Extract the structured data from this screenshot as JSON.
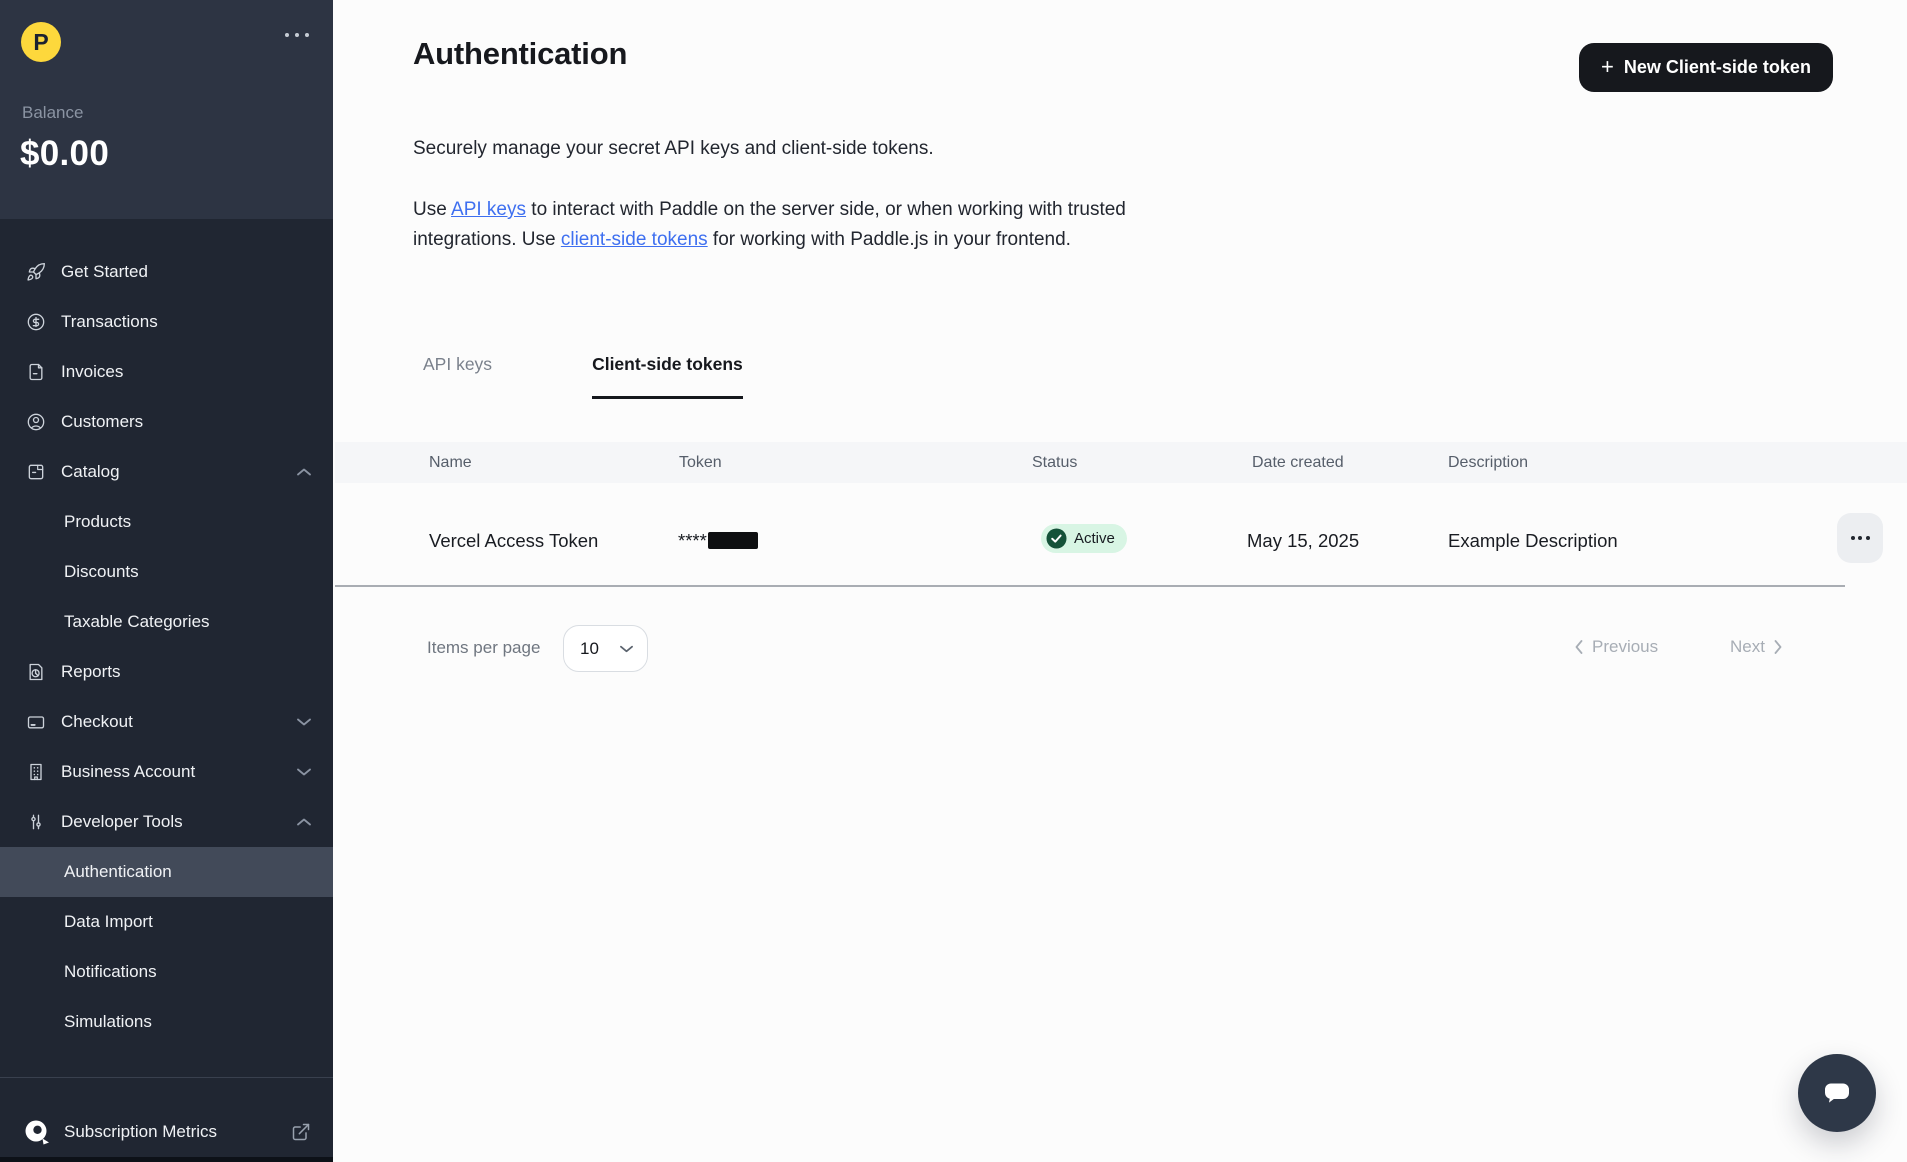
{
  "sidebar": {
    "logo_letter": "P",
    "balance_label": "Balance",
    "balance_value": "$0.00",
    "items": [
      {
        "label": "Get Started",
        "icon": "rocket-icon"
      },
      {
        "label": "Transactions",
        "icon": "dollar-circle-icon"
      },
      {
        "label": "Invoices",
        "icon": "invoice-icon"
      },
      {
        "label": "Customers",
        "icon": "user-circle-icon"
      },
      {
        "label": "Catalog",
        "icon": "box-icon",
        "chevron": "up"
      },
      {
        "label": "Products",
        "sub": true
      },
      {
        "label": "Discounts",
        "sub": true
      },
      {
        "label": "Taxable Categories",
        "sub": true
      },
      {
        "label": "Reports",
        "icon": "report-icon"
      },
      {
        "label": "Checkout",
        "icon": "credit-card-icon",
        "chevron": "down"
      },
      {
        "label": "Business Account",
        "icon": "building-icon",
        "chevron": "down"
      },
      {
        "label": "Developer Tools",
        "icon": "sliders-icon",
        "chevron": "up"
      },
      {
        "label": "Authentication",
        "sub": true,
        "selected": true
      },
      {
        "label": "Data Import",
        "sub": true
      },
      {
        "label": "Notifications",
        "sub": true
      },
      {
        "label": "Simulations",
        "sub": true
      }
    ],
    "footer_label": "Subscription Metrics"
  },
  "header": {
    "title": "Authentication",
    "new_token_button": "New Client-side token",
    "new_token_button_icon": "+"
  },
  "intro": {
    "line1": "Securely manage your secret API keys and client-side tokens.",
    "p2_before_link1": "Use ",
    "link1": "API keys",
    "p2_between_links": " to interact with Paddle on the server side, or when working with trusted integrations. Use ",
    "link2": "client-side tokens",
    "p2_after_link2": " for working with Paddle.js in your frontend."
  },
  "tabs": [
    {
      "label": "API keys",
      "active": false
    },
    {
      "label": "Client-side tokens",
      "active": true
    }
  ],
  "table": {
    "columns": [
      "Name",
      "Token",
      "Status",
      "Date created",
      "Description"
    ],
    "rows": [
      {
        "name": "Vercel Access Token",
        "token_masked": "****",
        "status": "Active",
        "date_created": "May 15, 2025",
        "description": "Example Description"
      }
    ]
  },
  "pagination": {
    "items_per_page_label": "Items per page",
    "page_size": "10",
    "previous_label": "Previous",
    "next_label": "Next"
  },
  "colors": {
    "sidebar_top": "#2d3443",
    "sidebar": "#202632",
    "selected_item": "#424a59",
    "accent_yellow": "#fdd83c",
    "primary_button": "#16181d",
    "link_blue": "#3e6ff0",
    "badge_bg": "#d8f5e4",
    "badge_check": "#155239",
    "table_header_bg": "#f5f6f8"
  }
}
